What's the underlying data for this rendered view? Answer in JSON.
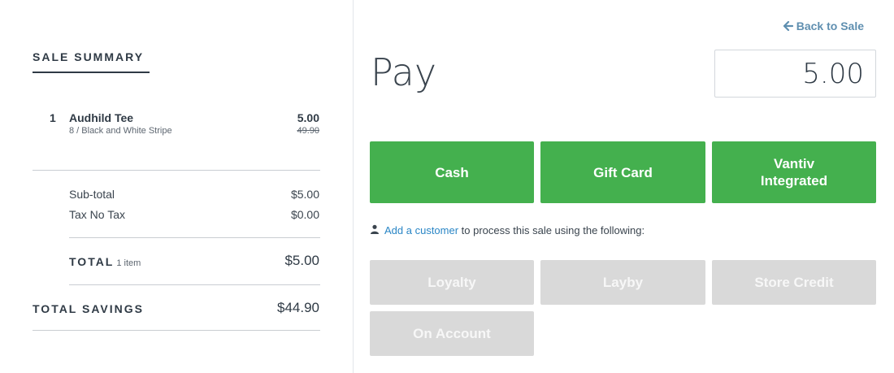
{
  "summary": {
    "title": "SALE SUMMARY",
    "line_items": [
      {
        "qty": "1",
        "name": "Audhild Tee",
        "variant": "8 / Black and White Stripe",
        "price": "5.00",
        "original_price": "49.90"
      }
    ],
    "subtotal_label": "Sub-total",
    "subtotal_value": "$5.00",
    "tax_label": "Tax No Tax",
    "tax_value": "$0.00",
    "total_label": "TOTAL",
    "total_count": "1 item",
    "total_value": "$5.00",
    "savings_label": "TOTAL SAVINGS",
    "savings_value": "$44.90"
  },
  "pay": {
    "back_label": "Back to Sale",
    "title": "Pay",
    "amount": "5.00",
    "payment_methods": [
      {
        "label": "Cash"
      },
      {
        "label": "Gift Card"
      },
      {
        "label": "Vantiv Integrated"
      }
    ],
    "customer_link": "Add a customer",
    "customer_text": "to process this sale using the following:",
    "customer_methods": [
      {
        "label": "Loyalty"
      },
      {
        "label": "Layby"
      },
      {
        "label": "Store Credit"
      },
      {
        "label": "On Account"
      }
    ]
  },
  "colors": {
    "accent_green": "#44b04e",
    "disabled_gray": "#d9d9d9",
    "link_blue": "#2a86c6",
    "back_link": "#5f8fb0"
  },
  "icons": {
    "back": "arrow-left-icon",
    "customer": "user-icon"
  }
}
